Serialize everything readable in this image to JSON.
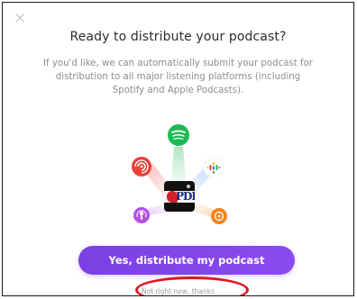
{
  "dialog": {
    "close_symbol": "×",
    "title": "Ready to distribute your podcast?",
    "description": "If you'd like, we can automatically submit your podcast for distribution to all major listening platforms (including Spotify and Apple Podcasts).",
    "primary_button": "Yes, distribute my podcast",
    "secondary_link": "Not right now, thanks"
  },
  "cover": {
    "text": "PDI"
  },
  "colors": {
    "accent": "#7b3fe4",
    "spotify": "#1db954",
    "castbox": "#e8413a",
    "google_podcasts": "#4285f4",
    "apple_podcasts": "#b150e2",
    "overcast": "#f6841f",
    "annotation": "#e0151f"
  },
  "icons": [
    "close-icon",
    "spotify-icon",
    "castbox-icon",
    "google-podcasts-icon",
    "apple-podcasts-icon",
    "overcast-icon"
  ]
}
